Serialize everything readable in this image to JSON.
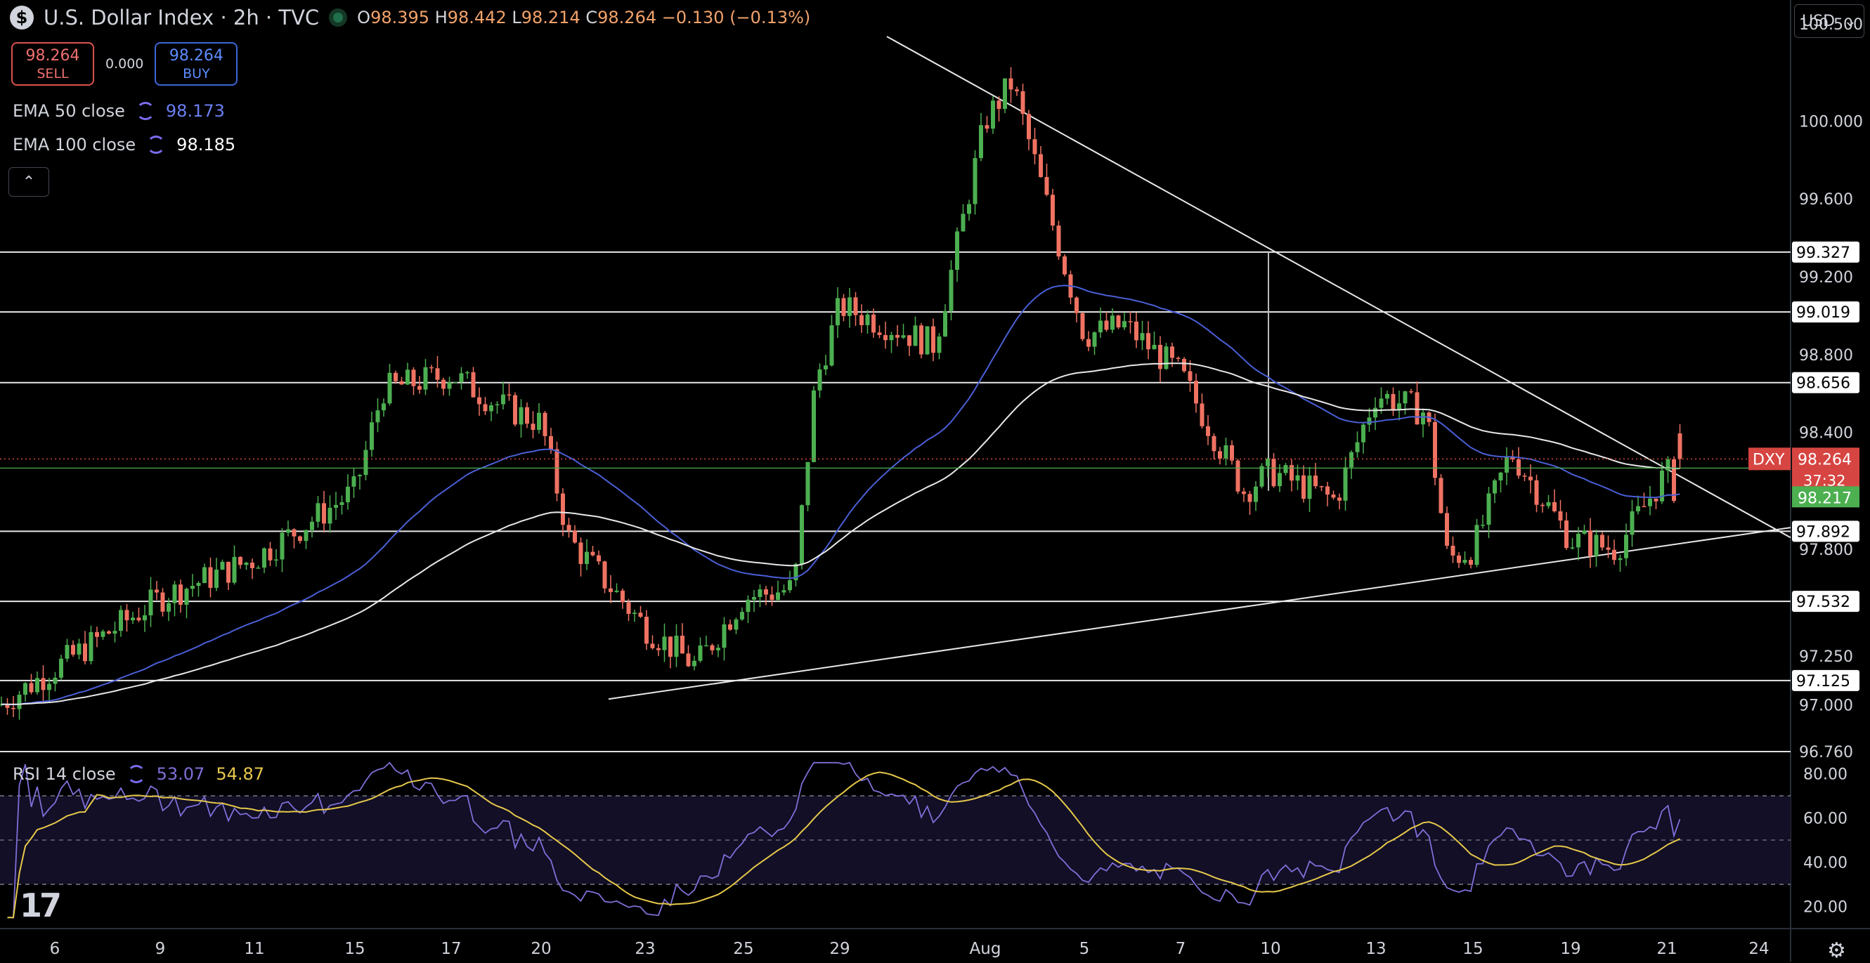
{
  "header": {
    "symbol_title": "U.S. Dollar Index · 2h · TVC",
    "ohlc": {
      "O": "98.395",
      "H": "98.442",
      "L": "98.214",
      "C": "98.264",
      "change": "−0.130 (−0.13%)"
    }
  },
  "trade": {
    "sell_price": "98.264",
    "sell_label": "SELL",
    "spread": "0.000",
    "buy_price": "98.264",
    "buy_label": "BUY"
  },
  "indicators": {
    "ema50_label": "EMA 50 close",
    "ema50_value": "98.173",
    "ema100_label": "EMA 100 close",
    "ema100_value": "98.185",
    "rsi_label": "RSI 14 close",
    "rsi_value": "53.07",
    "rsi_ma_value": "54.87"
  },
  "currency": "USD",
  "colors": {
    "bg": "#000000",
    "up": "#4caf50",
    "down": "#ef7262",
    "ema50": "#4a5fd6",
    "ema100": "#e8e8e8",
    "rsi": "#7e6fd8",
    "rsi_ma": "#e6c84a",
    "label_red": "#d64541",
    "label_green": "#4caf50"
  },
  "chart_data": {
    "type": "candlestick",
    "instrument": "DXY",
    "price_axis_ticks": [
      "100.500",
      "100.000",
      "99.600",
      "99.200",
      "98.800",
      "98.400",
      "97.800",
      "97.250",
      "97.000",
      "96.760"
    ],
    "ylim": [
      96.76,
      100.55
    ],
    "x_tick_labels": [
      "6",
      "9",
      "11",
      "15",
      "17",
      "20",
      "23",
      "25",
      "29",
      "Aug",
      "5",
      "7",
      "10",
      "13",
      "15",
      "19",
      "21",
      "24"
    ],
    "horizontal_levels": [
      "99.327",
      "99.019",
      "98.656",
      "97.892",
      "97.532",
      "97.125"
    ],
    "current_price_label": {
      "symbol": "DXY",
      "price": "98.264",
      "countdown": "37:32"
    },
    "green_price_label": "98.217",
    "trendlines": [
      {
        "from": [
          "Jul 29",
          100.62
        ],
        "to": [
          "Aug 24",
          97.95
        ],
        "label": ""
      },
      {
        "from": [
          "Jul 22",
          97.03
        ],
        "to": [
          "Aug 24",
          97.94
        ],
        "label": ""
      }
    ],
    "price_path_keypoints": [
      [
        "6",
        97.0
      ],
      [
        "9",
        97.55
      ],
      [
        "11",
        97.75
      ],
      [
        "15",
        98.1
      ],
      [
        "16",
        98.62
      ],
      [
        "17",
        98.7
      ],
      [
        "18",
        98.55
      ],
      [
        "20",
        98.45
      ],
      [
        "21",
        97.85
      ],
      [
        "23",
        97.4
      ],
      [
        "24",
        97.2
      ],
      [
        "25",
        97.55
      ],
      [
        "27",
        97.6
      ],
      [
        "28",
        98.65
      ],
      [
        "29",
        99.05
      ],
      [
        "30",
        98.85
      ],
      [
        "31",
        100.0
      ],
      [
        "Aug",
        100.2
      ],
      [
        "Aug 2",
        98.9
      ],
      [
        "5",
        98.95
      ],
      [
        "6",
        98.7
      ],
      [
        "7",
        98.1
      ],
      [
        "9",
        98.2
      ],
      [
        "10",
        98.05
      ],
      [
        "11",
        98.6
      ],
      [
        "12",
        98.5
      ],
      [
        "13",
        97.75
      ],
      [
        "14",
        97.8
      ],
      [
        "14.5",
        98.3
      ],
      [
        "15",
        97.85
      ],
      [
        "16",
        97.8
      ],
      [
        "18",
        98.2
      ],
      [
        "19",
        98.05
      ],
      [
        "20",
        98.4
      ],
      [
        "21",
        98.264
      ]
    ],
    "rsi_axis_ticks": [
      "80.00",
      "60.00",
      "40.00",
      "20.00"
    ],
    "rsi_ylim": [
      10,
      90
    ],
    "rsi_bands": [
      70,
      30
    ]
  }
}
